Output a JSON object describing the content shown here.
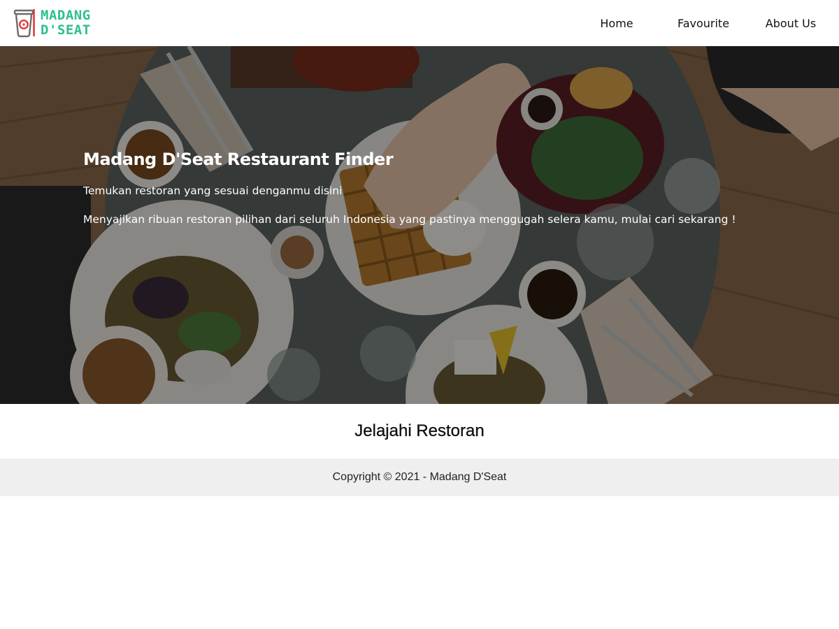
{
  "header": {
    "logo_text_line1": "MADANG",
    "logo_text_line2": "D'SEAT",
    "logo_icon": "cup-icon",
    "nav": [
      {
        "label": "Home"
      },
      {
        "label": "Favourite"
      },
      {
        "label": "About Us"
      }
    ]
  },
  "hero": {
    "title": "Madang D'Seat Restaurant Finder",
    "tagline": "Temukan restoran yang sesuai denganmu disini",
    "description": "Menyajikan ribuan restoran pilihan dari seluruh Indonesia yang pastinya menggugah selera kamu, mulai cari sekarang !"
  },
  "explore": {
    "title": "Jelajahi Restoran"
  },
  "footer": {
    "copyright": "Copyright © 2021 - Madang D'Seat"
  },
  "colors": {
    "brand_green": "#2dbf8f",
    "brand_red": "#e03b3b",
    "footer_bg": "#efefef"
  }
}
